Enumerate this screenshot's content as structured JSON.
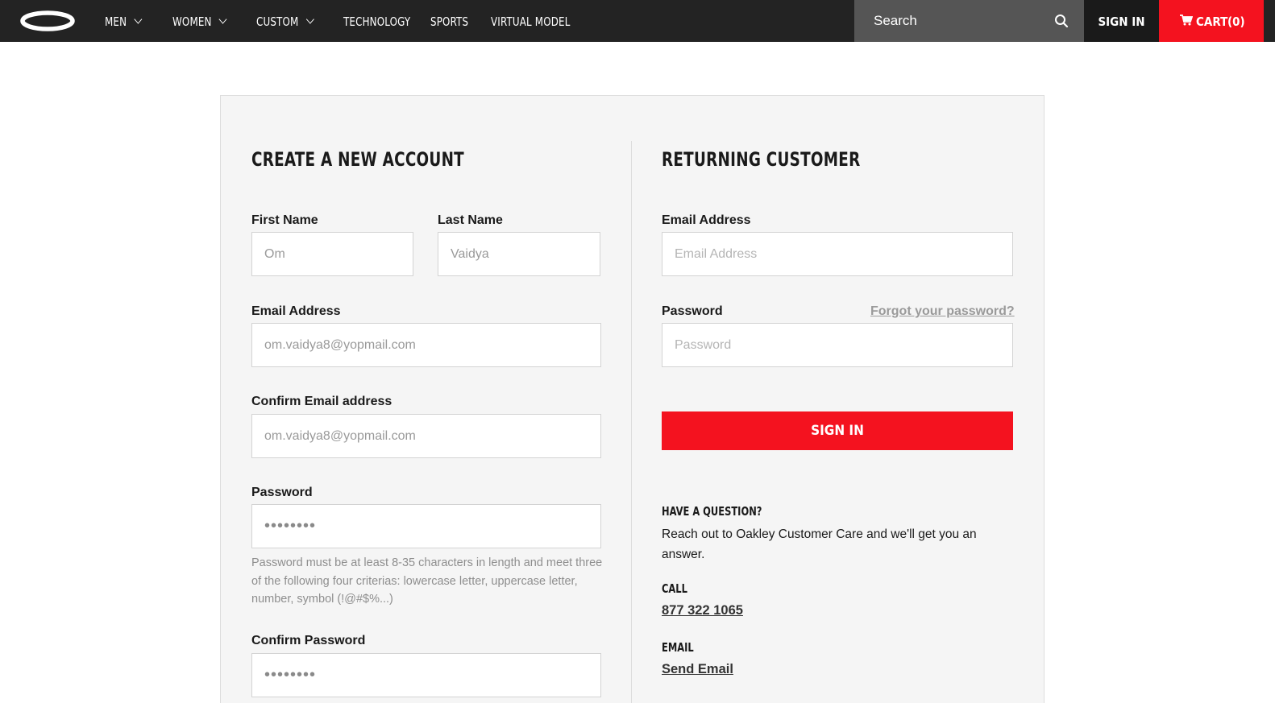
{
  "nav": {
    "logo": "oakley-ellipse-logo",
    "items": [
      {
        "label": "MEN",
        "has_dropdown": true
      },
      {
        "label": "WOMEN",
        "has_dropdown": true
      },
      {
        "label": "CUSTOM",
        "has_dropdown": true
      },
      {
        "label": "TECHNOLOGY",
        "has_dropdown": false
      },
      {
        "label": "SPORTS",
        "has_dropdown": false
      },
      {
        "label": "VIRTUAL MODEL",
        "has_dropdown": false
      }
    ],
    "search_placeholder": "Search",
    "search_icon": "search-icon",
    "sign_in": "SIGN IN",
    "cart": {
      "label": "CART",
      "count": "(0)",
      "icon": "cart-icon"
    }
  },
  "create_account": {
    "heading": "CREATE A NEW ACCOUNT",
    "first_name": {
      "label": "First Name",
      "value": "Om"
    },
    "last_name": {
      "label": "Last Name",
      "value": "Vaidya"
    },
    "email": {
      "label": "Email Address",
      "value": "om.vaidya8@yopmail.com"
    },
    "confirm_email": {
      "label": "Confirm Email address",
      "value": "om.vaidya8@yopmail.com"
    },
    "password": {
      "label": "Password",
      "value": "••••••••"
    },
    "password_hint": "Password must be at least 8-35 characters in length and meet three of the following four criterias: lowercase letter, uppercase letter, number, symbol (!@#$%...)",
    "confirm_password": {
      "label": "Confirm Password",
      "value": "••••••••"
    }
  },
  "returning_customer": {
    "heading": "RETURNING CUSTOMER",
    "email": {
      "label": "Email Address",
      "placeholder": "Email Address"
    },
    "password": {
      "label": "Password",
      "placeholder": "Password"
    },
    "forgot_link": "Forgot your password?",
    "sign_in_button": "SIGN IN"
  },
  "help": {
    "heading": "HAVE A QUESTION?",
    "text": "Reach out to Oakley Customer Care and we'll get you an answer.",
    "call_heading": "CALL",
    "phone": "877 322 1065",
    "email_heading": "EMAIL",
    "email_link": "Send Email"
  },
  "colors": {
    "nav_bg": "#232323",
    "accent_red": "#f4121f",
    "panel_bg": "#f5f5f5"
  }
}
